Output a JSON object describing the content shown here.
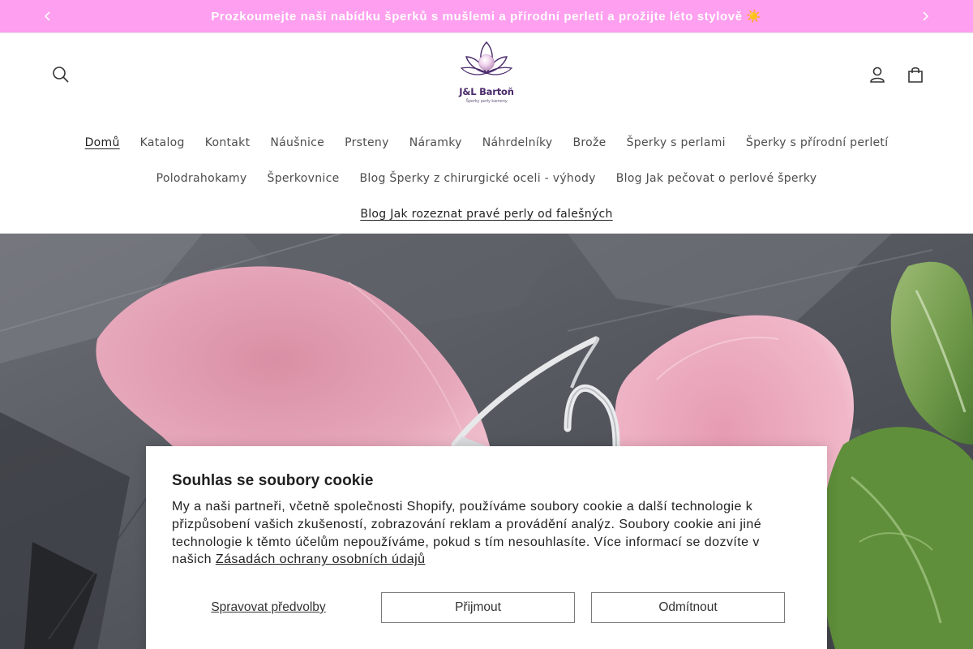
{
  "announcement": {
    "text": "Prozkoumejte naši nabídku šperků s mušlemi a přírodní perletí a prožijte léto stylově ☀️",
    "bg_color": "#ff9ff0",
    "prev_icon": "chevron-left-icon",
    "next_icon": "chevron-right-icon"
  },
  "header": {
    "logo": {
      "name": "J&L Bartoň",
      "tagline": "Šperky perly kameny"
    },
    "icons": {
      "search": "search-icon",
      "account": "user-icon",
      "cart": "bag-icon"
    }
  },
  "nav": {
    "row1": [
      "Domů",
      "Katalog",
      "Kontakt",
      "Náušnice",
      "Prsteny",
      "Náramky",
      "Náhrdelníky",
      "Brože",
      "Šperky s perlami",
      "Šperky s přírodní perletí"
    ],
    "row2": [
      "Polodrahokamy",
      "Šperkovnice",
      "Blog Šperky z chirurgické oceli - výhody",
      "Blog Jak pečovat o perlové šperky"
    ],
    "row3": [
      "Blog Jak rozeznat pravé perly od falešných"
    ],
    "active": "Domů"
  },
  "cookie": {
    "title": "Souhlas se soubory cookie",
    "body": "My a naši partneři, včetně společnosti Shopify, používáme soubory cookie a další technologie k přizpůsobení vašich zkušeností, zobrazování reklam a provádění analýz. Soubory cookie ani jiné technologie k těmto účelům nepoužíváme, pokud s tím nesouhlasíte. Více informací se dozvíte v našich",
    "link_text": "Zásadách ochrany osobních údajů",
    "manage_label": "Spravovat předvolby",
    "accept_label": "Přijmout",
    "decline_label": "Odmítnout"
  }
}
